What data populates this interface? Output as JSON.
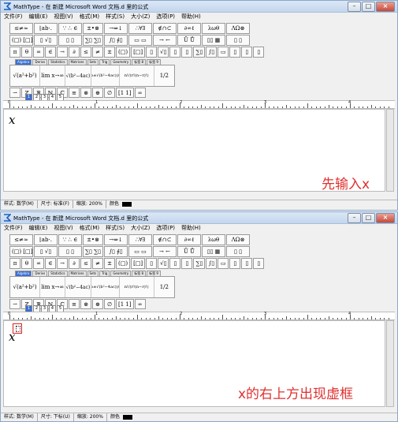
{
  "window1": {
    "title": "MathType - 在 新建 Microsoft Word 文档.d 里的公式",
    "menu": [
      "文件(F)",
      "编辑(E)",
      "视图(V)",
      "格式(M)",
      "样式(S)",
      "大小(Z)",
      "选项(P)",
      "帮助(H)"
    ],
    "toolbar_row1": [
      "≤≠≈",
      "⌊ab·.",
      "∵ ∴ ∈",
      "±•⊗",
      "→⇔↓",
      "∴∀∃",
      "∉∩⊂",
      "∂∞ℓ",
      "λωθ",
      "ΛΩ⊗"
    ],
    "toolbar_row2": [
      "(□) [□]",
      "▯ √▯",
      "▯ ▯",
      "∑▯ ∑▯",
      "∫▯ ∮▯",
      "▭ ▭",
      "→ ←",
      "Ū Ů",
      "▯▯ ▦",
      "▯ ▯"
    ],
    "toolbar_row3": [
      "π",
      "θ",
      "∞",
      "∈",
      "→",
      "∂",
      "≤",
      "≠",
      "±",
      "(□)",
      "[□]",
      "▯",
      "√▯",
      "▯",
      "▯",
      "∑▯",
      "∫▯",
      "▭",
      "▯",
      "▯",
      "▯"
    ],
    "tabs": [
      "Algebra",
      "Derivs",
      "Statistics",
      "Matrices",
      "Sets",
      "Trig",
      "Geometry",
      "标签 8",
      "标签 9"
    ],
    "templates_top": [
      "√(a²+b²)",
      "lim x→∞",
      "√(b²−4ac)",
      "(−b±√(b²−4ac))/2a",
      "n!/(r!(n−r)!)",
      "1/2"
    ],
    "templates_bottom": [
      "⇀",
      "ℤ",
      "ℝ",
      "ℕ",
      "ℂ",
      "≡",
      "⊗",
      "⊕",
      "∅",
      "[1 1]",
      "∞"
    ],
    "expression": "x",
    "caption": "先输入x",
    "status": {
      "style_label": "样式",
      "style_value": "数学(M)",
      "size_label": "尺寸",
      "size_value": "标准(F)",
      "zoom_label": "缩放",
      "zoom_value": "200%",
      "color_label": "颜色"
    }
  },
  "window2": {
    "title": "MathType - 在 新建 Microsoft Word 文档.d 里的公式",
    "menu": [
      "文件(F)",
      "编辑(E)",
      "视图(V)",
      "格式(M)",
      "样式(S)",
      "大小(Z)",
      "选项(P)",
      "帮助(H)"
    ],
    "toolbar_row1": [
      "≤≠≈",
      "⌊ab·.",
      "∵ ∴ ∈",
      "±•⊗",
      "→⇔↓",
      "∴∀∃",
      "∉∩⊂",
      "∂∞ℓ",
      "λωθ",
      "ΛΩ⊗"
    ],
    "toolbar_row2": [
      "(□) [□]",
      "▯ √▯",
      "▯ ▯",
      "∑▯ ∑▯",
      "∫▯ ∮▯",
      "▭ ▭",
      "→ ←",
      "Ū Ů",
      "▯▯ ▦",
      "▯ ▯"
    ],
    "toolbar_row3": [
      "π",
      "θ",
      "∞",
      "∈",
      "→",
      "∂",
      "≤",
      "≠",
      "±",
      "(□)",
      "[□]",
      "▯",
      "√▯",
      "▯",
      "▯",
      "∑▯",
      "∫▯",
      "▭",
      "▯",
      "▯",
      "▯"
    ],
    "tabs": [
      "Algebra",
      "Derivs",
      "Statistics",
      "Matrices",
      "Sets",
      "Trig",
      "Geometry",
      "标签 8",
      "标签 9"
    ],
    "templates_top": [
      "√(a²+b²)",
      "lim x→∞",
      "√(b²−4ac)",
      "(−b±√(b²−4ac))/2a",
      "n!/(r!(n−r)!)",
      "1/2"
    ],
    "templates_bottom": [
      "⇀",
      "ℤ",
      "ℝ",
      "ℕ",
      "ℂ",
      "≡",
      "⊗",
      "⊕",
      "∅",
      "[1 1]",
      "∞"
    ],
    "expression": "x",
    "caption": "x的右上方出现虚框",
    "status": {
      "style_label": "样式",
      "style_value": "数学(M)",
      "size_label": "尺寸",
      "size_value": "下标(U)",
      "zoom_label": "缩放",
      "zoom_value": "200%",
      "color_label": "颜色"
    }
  },
  "ruler_labels": [
    "0",
    "1",
    "2",
    "3",
    "4"
  ],
  "colors": {
    "caption": "#e03030",
    "placeholder_box": "#e02020",
    "active_tab": "#3a6fd0"
  }
}
